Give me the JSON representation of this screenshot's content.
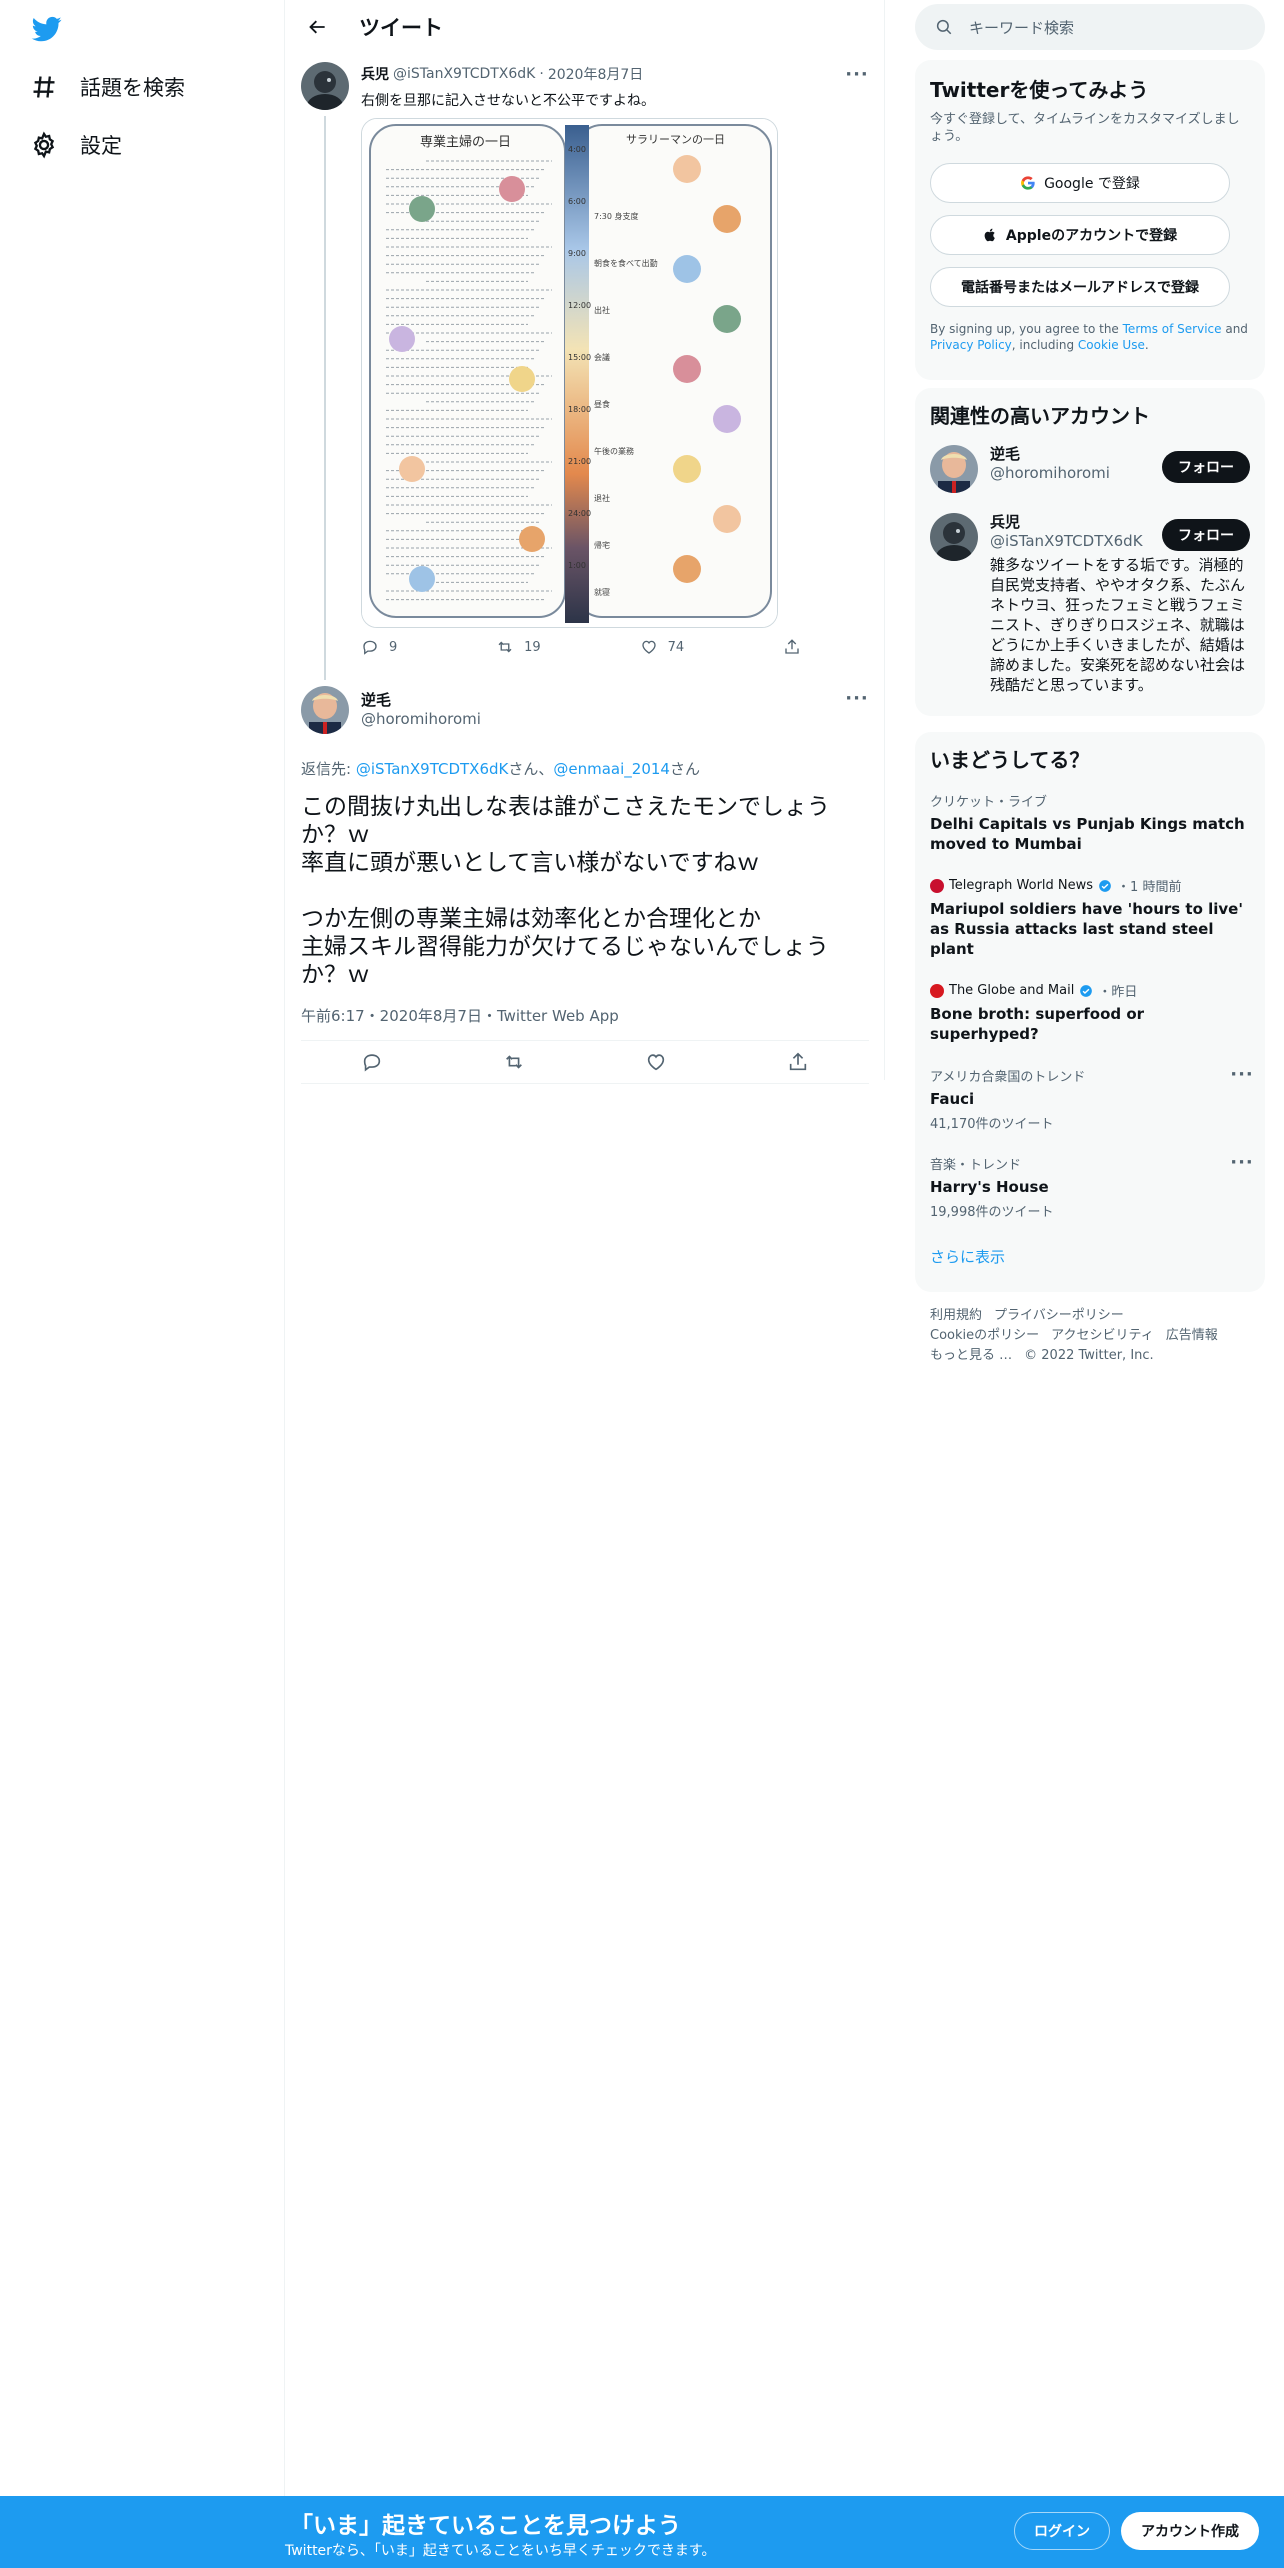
{
  "nav": {
    "explore": "話題を検索",
    "settings": "設定"
  },
  "header": {
    "title": "ツイート"
  },
  "parent_tweet": {
    "name": "兵児",
    "handle": "@iSTanX9TCDTX6dK",
    "date": "2020年8月7日",
    "text": "右側を旦那に記入させないと不公平ですよね。",
    "media": {
      "left_title": "専業主婦の一日",
      "right_title": "サラリーマンの一日",
      "times": [
        "4:00",
        "6:00",
        "9:00",
        "12:00",
        "15:00",
        "18:00",
        "21:00",
        "24:00",
        "1:00"
      ],
      "right_notes": [
        "7:30 身支度",
        "朝食を食べて出勤",
        "出社",
        "会議",
        "昼食",
        "午後の業務",
        "退社",
        "帰宅",
        "就寝"
      ]
    },
    "replies": "9",
    "retweets": "19",
    "likes": "74"
  },
  "focus_tweet": {
    "name": "逆毛",
    "handle": "@horomihoromi",
    "replying_prefix": "返信先: ",
    "replying_to_1": "@iSTanX9TCDTX6dK",
    "replying_sep": "さん、",
    "replying_to_2": "@enmaai_2014",
    "replying_suffix": "さん",
    "text": "この間抜け丸出しな表は誰がこさえたモンでしょうか？ｗ\n率直に頭が悪いとして言い様がないですねｗ\n\nつか左側の専業主婦は効率化とか合理化とか\n主婦スキル習得能力が欠けてるじゃないんでしょうか？ｗ",
    "timestamp": "午前6:17・2020年8月7日・Twitter Web App"
  },
  "search": {
    "placeholder": "キーワード検索"
  },
  "signup": {
    "title": "Twitterを使ってみよう",
    "subtitle": "今すぐ登録して、タイムラインをカスタマイズしましょう。",
    "google": "Google で登録",
    "apple": "Appleのアカウントで登録",
    "phone": "電話番号またはメールアドレスで登録",
    "terms_1": "By signing up, you agree to the ",
    "terms_tos": "Terms of Service",
    "terms_2": " and ",
    "terms_privacy": "Privacy Policy",
    "terms_3": ", including ",
    "terms_cookie": "Cookie Use",
    "terms_4": "."
  },
  "related": {
    "title": "関連性の高いアカウント",
    "follow": "フォロー",
    "accounts": [
      {
        "name": "逆毛",
        "handle": "@horomihoromi"
      },
      {
        "name": "兵児",
        "handle": "@iSTanX9TCDTX6dK",
        "bio": "雑多なツイートをする垢です。消極的自民党支持者、ややオタク系、たぶんネトウヨ、狂ったフェミと戦うフェミニスト、ぎりぎりロスジェネ、就職はどうにか上手くいきましたが、結婚は諦めました。安楽死を認めない社会は残酷だと思っています。"
      }
    ]
  },
  "trends": {
    "title": "いまどうしてる？",
    "items": [
      {
        "context": "クリケット・ライブ",
        "title": "Delhi Capitals vs Punjab Kings match moved to Mumbai"
      },
      {
        "source": "Telegraph World News",
        "time": "・1 時間前",
        "title": "Mariupol soldiers have 'hours to live' as Russia attacks last stand steel plant"
      },
      {
        "source": "The Globe and Mail",
        "time": "・昨日",
        "title": "Bone broth: superfood or superhyped?"
      },
      {
        "context": "アメリカ合衆国のトレンド",
        "title": "Fauci",
        "count": "41,170件のツイート"
      },
      {
        "context": "音楽・トレンド",
        "title": "Harry's House",
        "count": "19,998件のツイート"
      }
    ],
    "show_more": "さらに表示"
  },
  "footer": {
    "terms": "利用規約",
    "privacy": "プライバシーポリシー",
    "cookie": "Cookieのポリシー",
    "accessibility": "アクセシビリティ",
    "ads": "広告情報",
    "more": "もっと見る …",
    "copyright": "© 2022 Twitter, Inc."
  },
  "banner": {
    "title": "「いま」起きていることを見つけよう",
    "subtitle": "Twitterなら、「いま」起きていることをいち早くチェックできます。",
    "login": "ログイン",
    "signup": "アカウント作成"
  },
  "colors": {
    "accent": "#1d9bf0",
    "text": "#0f1419",
    "muted": "#536471"
  }
}
